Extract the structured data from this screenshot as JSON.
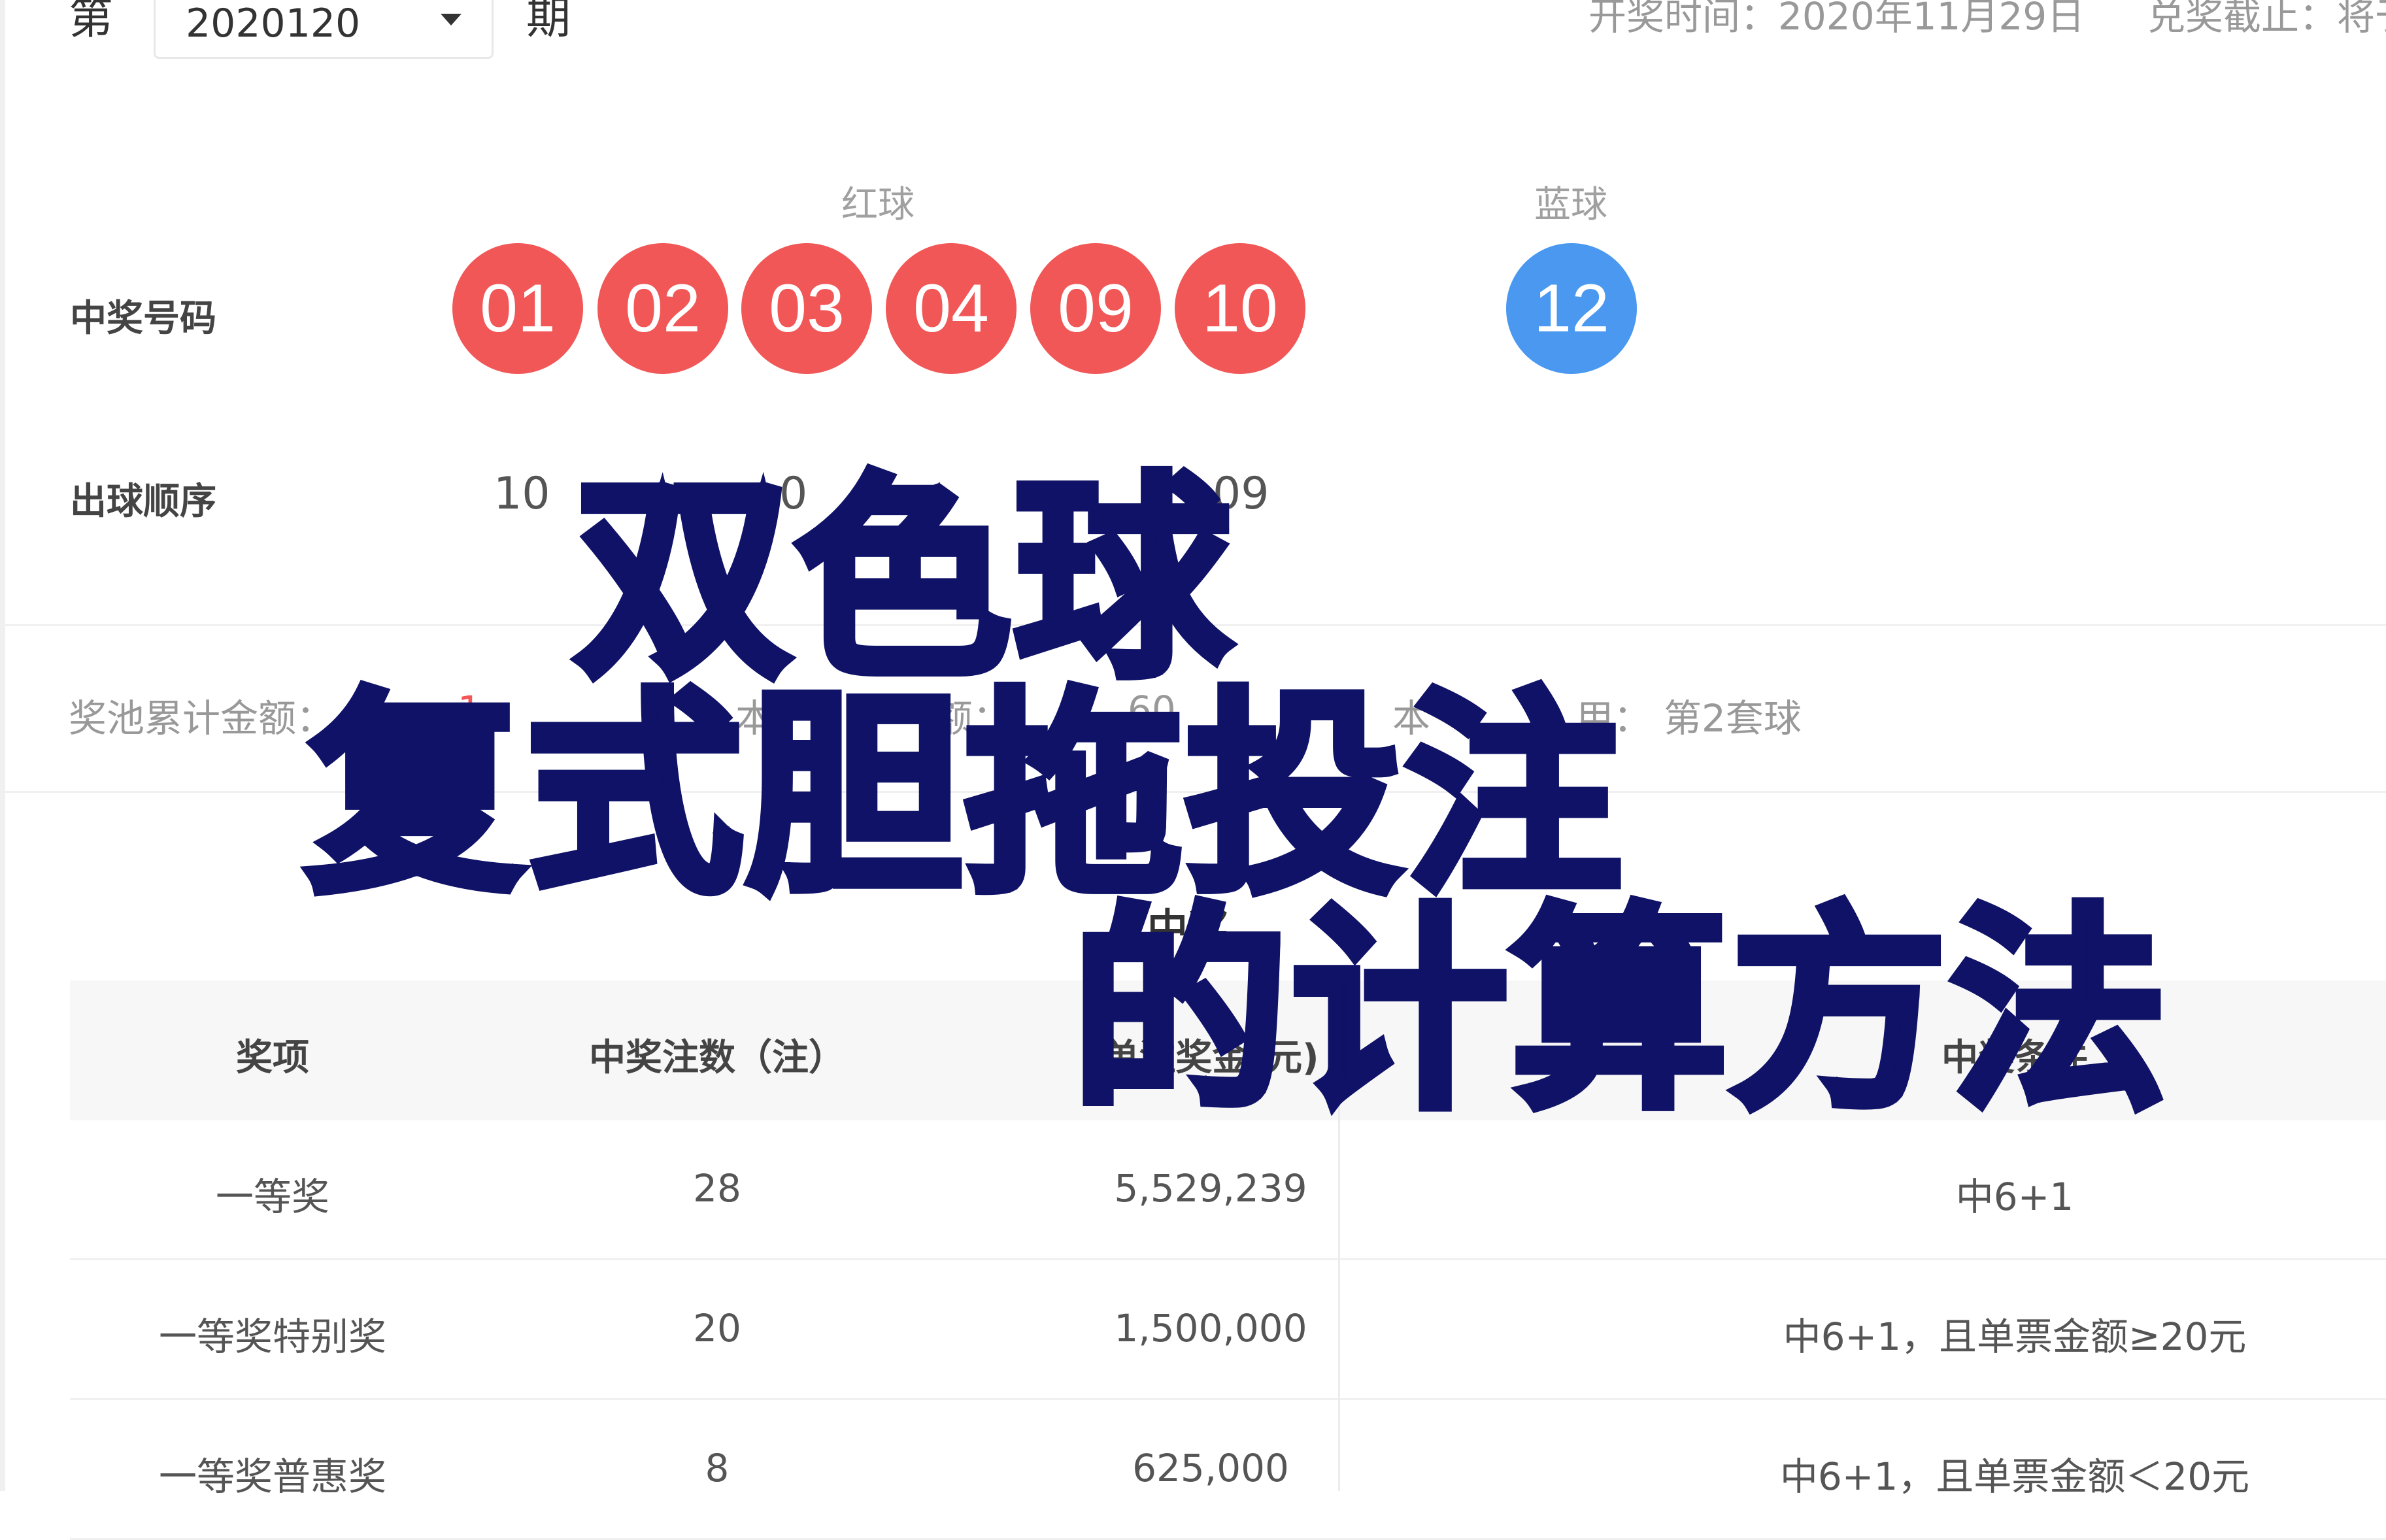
{
  "header": {
    "issue_prefix": "第",
    "issue_value": "2020120",
    "issue_suffix": "期",
    "draw_time": "开奖时间：2020年11月29日",
    "deadline": "兑奖截止：将于"
  },
  "balls": {
    "red_label": "红球",
    "blue_label": "蓝球",
    "winning_label": "中奖号码",
    "red": [
      "01",
      "02",
      "03",
      "04",
      "09",
      "10"
    ],
    "blue": "12",
    "order_label": "出球顺序",
    "order_visible": [
      "10",
      "0",
      "09"
    ],
    "red_color": "#f25757",
    "blue_color": "#4a98f0"
  },
  "stats": {
    "pool_label": "奖池累计金额：",
    "pool_amount_partial": "1",
    "sales_label": "本",
    "sales_label_tail": "额：",
    "sales_partial": "60",
    "ballset_label": "本",
    "ballset_tail": "用：",
    "ballset_value": "第2套球"
  },
  "section_title_partial": "中奖",
  "table": {
    "headers": [
      "奖项",
      "中奖注数（注）",
      "单注奖金(元)",
      "中奖条件"
    ],
    "rows": [
      [
        "一等奖",
        "28",
        "5,529,239",
        "中6+1"
      ],
      [
        "一等奖特别奖",
        "20",
        "1,500,000",
        "中6+1，且单票金额≥20元"
      ],
      [
        "一等奖普惠奖",
        "8",
        "625,000",
        "中6+1，且单票金额＜20元"
      ]
    ]
  },
  "overlay": {
    "line1": "双色球",
    "line2": "复式胆拖投注",
    "line3": "的计算方法",
    "color": "#0f1266"
  }
}
